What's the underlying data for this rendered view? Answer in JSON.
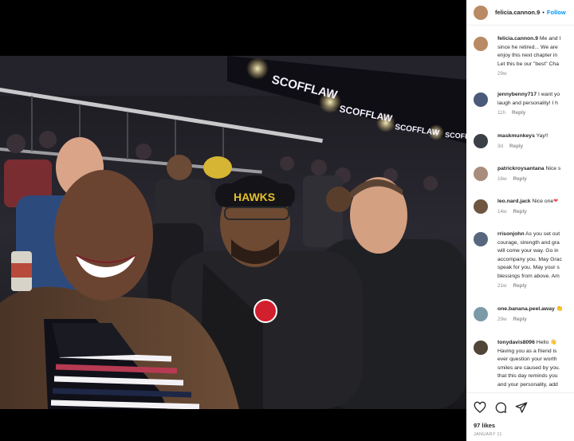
{
  "post": {
    "author": "felicia.cannon.9",
    "follow_label": "Follow",
    "separator": "•",
    "photo_banner_text": "SCOFFLAW",
    "cap_logo_text": "HAWKS",
    "likes": "97 likes",
    "date": "JANUARY 11"
  },
  "comments": [
    {
      "username": "felicia.cannon.9",
      "lines": [
        " Me and I",
        "since he retired... We are",
        "enjoy this next chapter in",
        "Let this be our \"best\" Cha"
      ],
      "time": "29w",
      "reply": "",
      "avatar_color": "#b98a63"
    },
    {
      "username": "jennybenny717",
      "lines": [
        " I want yo",
        "laugh and personality! I h"
      ],
      "time": "11h",
      "reply": "Reply",
      "avatar_color": "#4a5a78"
    },
    {
      "username": "maskmunkeys",
      "lines": [
        " Yay!!"
      ],
      "time": "3d",
      "reply": "Reply",
      "avatar_color": "#3b3f46"
    },
    {
      "username": "patrickroysantana",
      "lines": [
        " Nice s"
      ],
      "time": "16w",
      "reply": "Reply",
      "avatar_color": "#a88c7c"
    },
    {
      "username": "leo.nard.jack",
      "lines": [
        " Nice one"
      ],
      "heart": "❤",
      "time": "14w",
      "reply": "Reply",
      "avatar_color": "#6e5640"
    },
    {
      "username": "rrisonjohn",
      "lines": [
        " As you set out",
        "courage, strength and gra",
        "will come your way. Go in",
        "accompany you. May Grac",
        "speak for you. May your s",
        "blessings from above. Am"
      ],
      "time": "21w",
      "reply": "Reply",
      "avatar_color": "#56677e"
    },
    {
      "username": "one.banana.peel.away",
      "lines": [
        " 👏"
      ],
      "time": "29w",
      "reply": "Reply",
      "avatar_color": "#7a9aa8"
    },
    {
      "username": "tonydavis8096",
      "lines": [
        " Hello 👋",
        "Having you as a friend is",
        "ever question your worth",
        "smiles are caused by you.",
        "that this day reminds you",
        "and your personality, add"
      ],
      "time": "",
      "reply": "",
      "avatar_color": "#514537"
    }
  ],
  "icons": [
    "heart-icon",
    "comment-icon",
    "share-icon"
  ],
  "colors": {
    "link_blue": "#0095f6",
    "text": "#262626",
    "muted": "#8e8e8e",
    "like_red": "#ed4956"
  }
}
